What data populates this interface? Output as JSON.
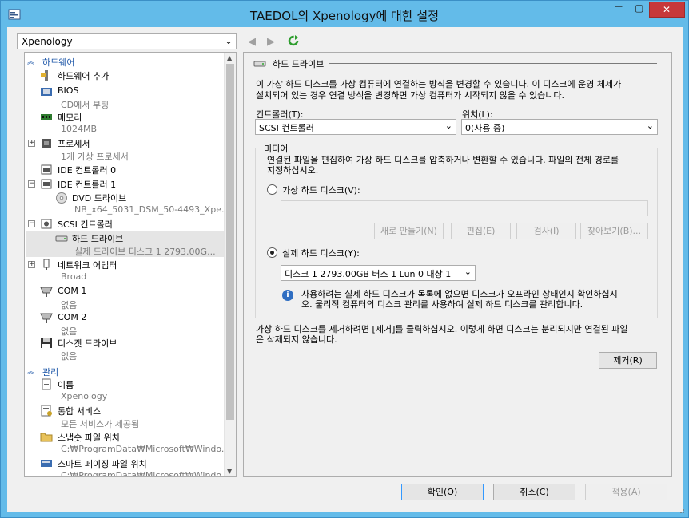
{
  "window": {
    "title": "TAEDOL의 Xpenology에 대한 설정",
    "minimize_glyph": "—",
    "maximize_glyph": "▢",
    "close_glyph": "✕"
  },
  "vm_selector": {
    "value": "Xpenology",
    "chevron": "⌄"
  },
  "nav": {
    "back_glyph": "◀",
    "forward_glyph": "▶"
  },
  "tree": {
    "hardware_section": "하드웨어",
    "management_section": "관리",
    "items": {
      "add_hardware": {
        "name": "하드웨어 추가"
      },
      "bios": {
        "name": "BIOS",
        "sub": "CD에서 부팅"
      },
      "memory": {
        "name": "메모리",
        "sub": "1024MB"
      },
      "processor": {
        "name": "프로세서",
        "sub": "1개 가상 프로세서"
      },
      "ide0": {
        "name": "IDE 컨트롤러 0"
      },
      "ide1": {
        "name": "IDE 컨트롤러 1"
      },
      "dvd": {
        "name": "DVD 드라이브",
        "sub": "NB_x64_5031_DSM_50-4493_Xpe..."
      },
      "scsi": {
        "name": "SCSI 컨트롤러"
      },
      "hdd": {
        "name": "하드 드라이브",
        "sub": "실제 드라이브 디스크 1 2793.00G..."
      },
      "nic": {
        "name": "네트워크 어댑터",
        "sub": "Broad"
      },
      "com1": {
        "name": "COM 1",
        "sub": "없음"
      },
      "com2": {
        "name": "COM 2",
        "sub": "없음"
      },
      "floppy": {
        "name": "디스켓 드라이브",
        "sub": "없음"
      },
      "name": {
        "name": "이름",
        "sub": "Xpenology"
      },
      "integration": {
        "name": "통합 서비스",
        "sub": "모든 서비스가 제공됨"
      },
      "snapshot": {
        "name": "스냅숏 파일 위치",
        "sub": "C:₩ProgramData₩Microsoft₩Windo..."
      },
      "smart_paging": {
        "name": "스마트 페이징 파일 위치",
        "sub": "C:₩ProgramData₩Microsoft₩Windo..."
      }
    }
  },
  "panel": {
    "title": "하드 드라이브",
    "intro_line1": "이 가상 하드 디스크를 가상 컴퓨터에 연결하는 방식을 변경할 수 있습니다. 이 디스크에 운영 체제가",
    "intro_line2": "설치되어 있는 경우 연결 방식을 변경하면 가상 컴퓨터가 시작되지 않을 수 있습니다.",
    "controller_label": "컨트롤러(T):",
    "controller_value": "SCSI 컨트롤러",
    "location_label": "위치(L):",
    "location_value": "0(사용 중)",
    "media_legend": "미디어",
    "media_line1": "연결된 파일을 편집하여 가상 하드 디스크를 압축하거나 변환할 수 있습니다. 파일의 전체 경로를",
    "media_line2": "지정하십시오.",
    "virtual_disk_label": "가상 하드 디스크(V):",
    "btn_new": "새로 만들기(N)",
    "btn_edit": "편집(E)",
    "btn_inspect": "검사(I)",
    "btn_browse": "찾아보기(B)...",
    "physical_disk_label": "실제 하드 디스크(Y):",
    "physical_disk_value": "디스크 1 2793.00GB 버스 1 Lun 0 대상 1",
    "info_line1": "사용하려는 실제 하드 디스크가 목록에 없으면 디스크가 오프라인 상태인지 확인하십시",
    "info_line2": "오. 물리적 컴퓨터의 디스크 관리를 사용하여 실제 하드 디스크를 관리합니다.",
    "remove_line1": "가상 하드 디스크를 제거하려면 [제거]를 클릭하십시오. 이렇게 하면 디스크는 분리되지만 연결된 파일",
    "remove_line2": "은 삭제되지 않습니다.",
    "btn_remove": "제거(R)"
  },
  "footer": {
    "ok": "확인(O)",
    "cancel": "취소(C)",
    "apply": "적용(A)"
  }
}
